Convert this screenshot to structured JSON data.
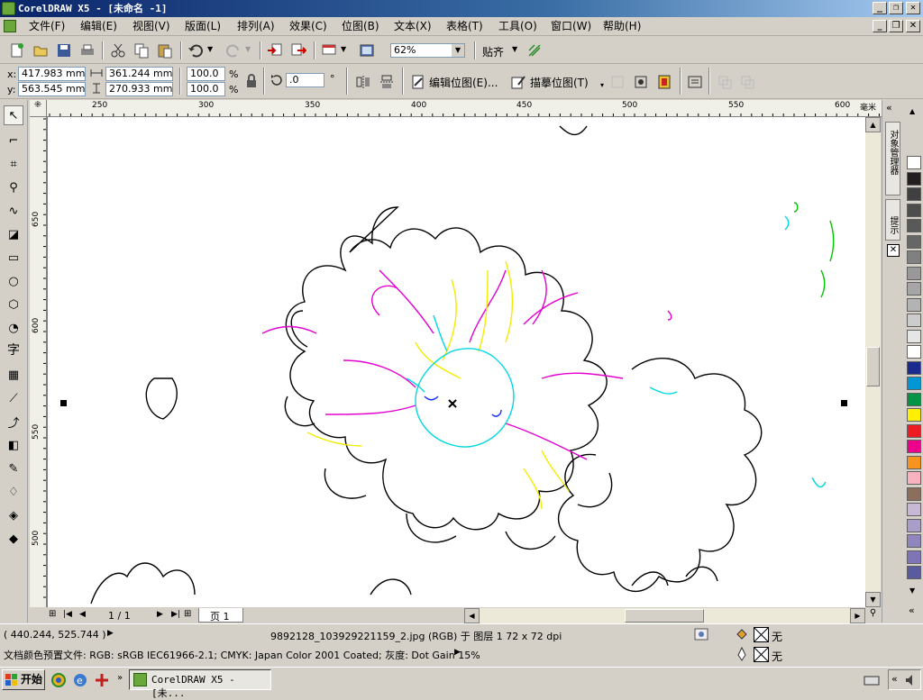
{
  "app": {
    "title": "CorelDRAW X5 - [未命名 -1]"
  },
  "window_controls": {
    "minimize": "_",
    "restore": "❐",
    "close": "✕"
  },
  "menu": [
    "文件(F)",
    "编辑(E)",
    "视图(V)",
    "版面(L)",
    "排列(A)",
    "效果(C)",
    "位图(B)",
    "文本(X)",
    "表格(T)",
    "工具(O)",
    "窗口(W)",
    "帮助(H)"
  ],
  "standard_toolbar": {
    "zoom_value": "62%",
    "snap_label": "贴齐"
  },
  "property_bar": {
    "x_label": "x:",
    "x_value": "417.983 mm",
    "y_label": "y:",
    "y_value": "563.545 mm",
    "width_value": "361.244 mm",
    "height_value": "270.933 mm",
    "scale_x": "100.0",
    "scale_y": "100.0",
    "percent": "%",
    "rotation_value": ".0",
    "degree": "°",
    "edit_bitmap_label": "编辑位图(E)...",
    "trace_bitmap_label": "描摹位图(T)"
  },
  "rulers": {
    "unit": "毫米",
    "h_ticks": [
      "250",
      "300",
      "350",
      "400",
      "450",
      "500",
      "550",
      "600"
    ],
    "v_ticks": [
      "650",
      "600",
      "550",
      "500"
    ]
  },
  "page_nav": {
    "page_count": "1 / 1",
    "page_tab": "页 1"
  },
  "docker": {
    "tab1": "对象管理器",
    "tab2": "提示"
  },
  "status": {
    "coords": "( 440.244, 525.744 )",
    "object_info": "9892128_103929221159_2.jpg (RGB) 于 图层 1 72 x 72 dpi",
    "color_profile": "文档颜色预置文件: RGB: sRGB IEC61966-2.1; CMYK: Japan Color 2001 Coated; 灰度: Dot Gain 15%",
    "fill_label": "无",
    "outline_label": "无"
  },
  "taskbar": {
    "start_label": "开始",
    "task_label": "CorelDRAW X5 - [未..."
  },
  "palette_colors": [
    "#ffffff",
    "#231f20",
    "#404040",
    "#4d4d4d",
    "#595959",
    "#666666",
    "#808080",
    "#999999",
    "#a6a6a6",
    "#b3b3b3",
    "#cccccc",
    "#e6e6e6",
    "#ffffff",
    "#1b2a8e",
    "#0096d6",
    "#009444",
    "#ffef00",
    "#ed1c24",
    "#ec008c",
    "#f7941d",
    "#f9b2c0",
    "#8c6e5d",
    "#c7b8d6",
    "#a89ec9",
    "#8f86bd",
    "#7f74b5",
    "#5a5a9e"
  ]
}
